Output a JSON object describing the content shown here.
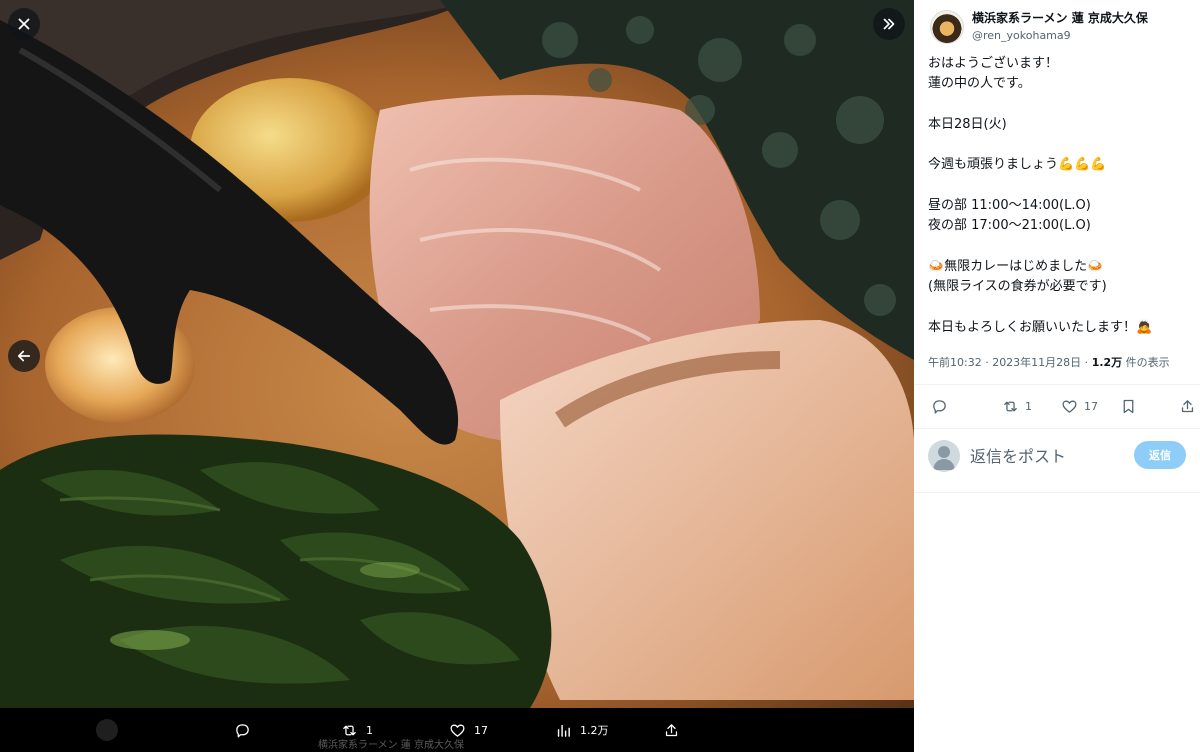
{
  "media_bar": {
    "retweet_count": "1",
    "like_count": "17",
    "view_count": "1.2万",
    "ghost_caption": "横浜家系ラーメン 蓮 京成大久保"
  },
  "tweet": {
    "display_name": "横浜家系ラーメン 蓮 京成大久保",
    "handle": "@ren_yokohama9",
    "body": "おはようございます！\n蓮の中の人です。\n\n本日28日(火)\n\n今週も頑張りましょう💪💪💪\n\n昼の部 11:00〜14:00(L.O)\n夜の部 17:00〜21:00(L.O)\n\n🍛無限カレーはじめました🍛\n(無限ライスの食券が必要です)\n\n本日もよろしくお願いいたします！🙇",
    "timestamp": "午前10:32 · 2023年11月28日",
    "views_number": "1.2万",
    "views_label": " 件の表示",
    "retweet_count": "1",
    "like_count": "17"
  },
  "reply": {
    "placeholder": "返信をポスト",
    "button_label": "返信"
  },
  "colors": {
    "accent": "#1d9bf0",
    "reply_button_disabled": "#8ecdf8",
    "muted_text": "#536471"
  },
  "icons": [
    "close-icon",
    "expand-icon",
    "back-arrow-icon",
    "reply-icon",
    "retweet-icon",
    "like-icon",
    "bookmark-icon",
    "share-icon",
    "views-icon",
    "avatar-placeholder-icon"
  ]
}
